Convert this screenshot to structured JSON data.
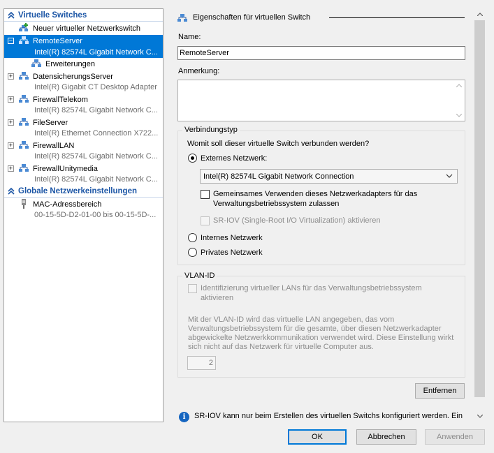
{
  "tree": {
    "section_switches": "Virtuelle Switches",
    "new_switch": "Neuer virtueller Netzwerkswitch",
    "switches": [
      {
        "name": "RemoteServer",
        "adapter": "Intel(R) 82574L Gigabit Network C...",
        "expander": "⊟",
        "selected": true
      },
      {
        "name": "DatensicherungsServer",
        "adapter": "Intel(R) Gigabit CT Desktop Adapter",
        "expander": "+"
      },
      {
        "name": "FirewallTelekom",
        "adapter": "Intel(R) 82574L Gigabit Network C...",
        "expander": "+"
      },
      {
        "name": "FileServer",
        "adapter": "Intel(R) Ethernet Connection X722...",
        "expander": "+"
      },
      {
        "name": "FirewallLAN",
        "adapter": "Intel(R) 82574L Gigabit Network C...",
        "expander": "+"
      },
      {
        "name": "FirewallUnitymedia",
        "adapter": "Intel(R) 82574L Gigabit Network C...",
        "expander": "+"
      }
    ],
    "extensions": "Erweiterungen",
    "section_global": "Globale Netzwerkeinstellungen",
    "mac_range_title": "MAC-Adressbereich",
    "mac_range_value": "00-15-5D-D2-01-00 bis 00-15-5D-..."
  },
  "props": {
    "header": "Eigenschaften für virtuellen Switch",
    "name_label": "Name:",
    "name_value": "RemoteServer",
    "note_label": "Anmerkung:",
    "note_value": "",
    "conn_group": "Verbindungstyp",
    "conn_question": "Womit soll dieser virtuelle Switch verbunden werden?",
    "external": "Externes Netzwerk:",
    "adapter_selected": "Intel(R) 82574L Gigabit Network Connection",
    "share_adapter_line1": "Gemeinsames Verwenden dieses Netzwerkadapters für das",
    "share_adapter_line2": "Verwaltungsbetriebssystem zulassen",
    "sriov": "SR-IOV (Single-Root I/O Virtualization) aktivieren",
    "internal": "Internes Netzwerk",
    "private": "Privates Netzwerk",
    "vlan_group": "VLAN-ID",
    "vlan_check_line1": "Identifizierung virtueller LANs für das Verwaltungsbetriebssystem",
    "vlan_check_line2": "aktivieren",
    "vlan_desc": [
      "Mit der VLAN-ID wird das virtuelle LAN angegeben, das vom",
      "Verwaltungsbetriebssystem für die gesamte, über diesen Netzwerkadapter",
      "abgewickelte Netzwerkkommunikation verwendet wird. Diese Einstellung wirkt",
      "sich nicht auf das Netzwerk für virtuelle Computer aus."
    ],
    "vlan_value": "2",
    "remove": "Entfernen",
    "info_text": "SR-IOV kann nur beim Erstellen des virtuellen Switchs konfiguriert werden. Ein"
  },
  "buttons": {
    "ok": "OK",
    "cancel": "Abbrechen",
    "apply": "Anwenden"
  },
  "colors": {
    "selection": "#0078d7",
    "section": "#1c56a6"
  }
}
